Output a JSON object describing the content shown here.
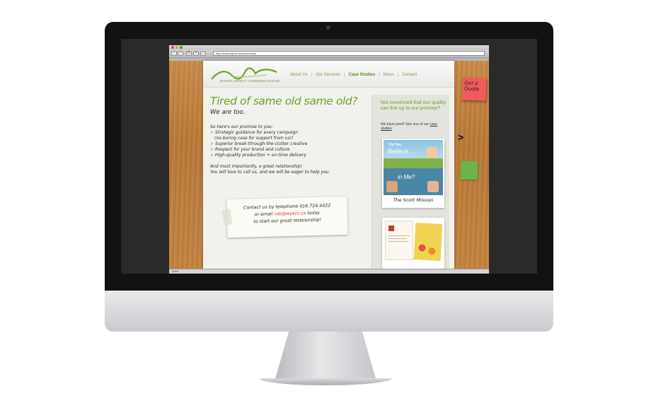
{
  "browser": {
    "url": "http://www.wyers.ca/ourservices",
    "status": "Done"
  },
  "site": {
    "logo_text": "WYERS DIRECT COMMUNICATIONS",
    "nav": [
      {
        "label": "About Us",
        "active": false
      },
      {
        "label": "Our Services",
        "active": false
      },
      {
        "label": "Case Studies",
        "active": true
      },
      {
        "label": "News",
        "active": false
      },
      {
        "label": "Contact",
        "active": false
      }
    ],
    "nav_separator": "|"
  },
  "main": {
    "headline": "Tired of same old same old?",
    "subhead": "We are too.",
    "promise_intro": "So here's our promise to you:",
    "bullets": [
      {
        "text": "Strategic guidance for every campaign",
        "sub": false
      },
      {
        "text": "(no boring case for support from us!)",
        "sub": true
      },
      {
        "text": "Superior break-through-the-clutter creative",
        "sub": false
      },
      {
        "text": "Respect for your brand and culture",
        "sub": false
      },
      {
        "text": "High-quality production + on-time delivery",
        "sub": false
      }
    ],
    "bullet_marker": ">",
    "closing_line1": "And most importantly, a great relationship!",
    "closing_line2": "You will love to call us, and we will be eager to help you."
  },
  "contact_note": {
    "line1": "Contact us by telephone 416.724.4422",
    "line2_prefix": "or email ",
    "email": "rob@wyers.ca",
    "line2_suffix": " today",
    "line3": "to start our great relationship!"
  },
  "sidebar": {
    "title": "Not convinced that our quality can live up to our promise?",
    "text": "We have proof! See one of our",
    "link": "case studies",
    "link_suffix": ":",
    "case_study_label": "The Scott Mission",
    "case_img_text1": "Do You",
    "case_img_text2": "Believe...",
    "case_img_text3": "in Me?"
  },
  "sticky_note": "Get a Quote",
  "next_arrow": ">",
  "colors": {
    "accent_green": "#6ba22a",
    "sticky_red": "#ef5b5b",
    "email_red": "#d43b2f"
  }
}
